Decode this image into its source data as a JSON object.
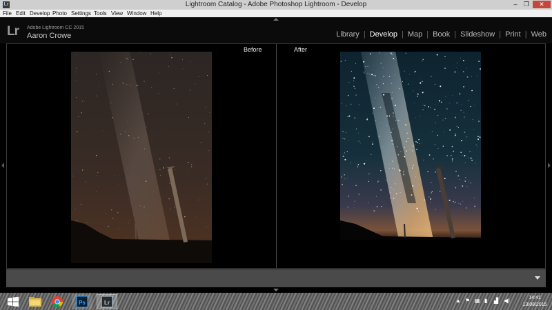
{
  "window": {
    "title": "Lightroom Catalog - Adobe Photoshop Lightroom - Develop",
    "app_icon": "Lr",
    "minimize_glyph": "–",
    "maximize_glyph": "❐",
    "close_glyph": "✕"
  },
  "menu": [
    "File",
    "Edit",
    "Develop",
    "Photo",
    "Settings",
    "Tools",
    "View",
    "Window",
    "Help"
  ],
  "identity": {
    "logo": "Lr",
    "product": "Adobe Lightroom CC 2015",
    "user": "Aaron Crowe"
  },
  "modules": [
    {
      "label": "Library",
      "active": false
    },
    {
      "label": "Develop",
      "active": true
    },
    {
      "label": "Map",
      "active": false
    },
    {
      "label": "Book",
      "active": false
    },
    {
      "label": "Slideshow",
      "active": false
    },
    {
      "label": "Print",
      "active": false
    },
    {
      "label": "Web",
      "active": false
    }
  ],
  "compare": {
    "before_label": "Before",
    "after_label": "After"
  },
  "taskbar": {
    "apps": [
      "windows-start-icon",
      "file-explorer-icon",
      "chrome-icon",
      "photoshop-icon",
      "lightroom-icon"
    ],
    "ps_label": "Ps",
    "lr_label": "Lr"
  },
  "clock": {
    "time": "14:41",
    "date": "13/08/2015"
  },
  "colors": {
    "lr_background": "#000000",
    "toolbar": "#4a4a4a",
    "close_button": "#c7463c",
    "photoshop_blue": "#31a8ff"
  }
}
